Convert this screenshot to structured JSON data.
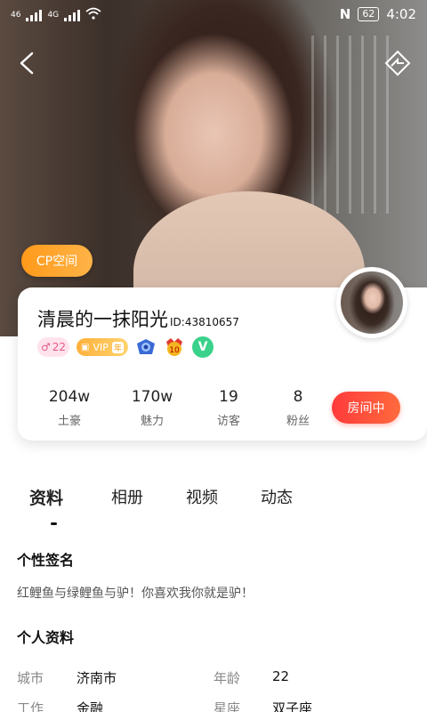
{
  "status_bar": {
    "sim_labels": [
      "46",
      "4G"
    ],
    "battery": "62",
    "time": "4:02",
    "nfc_label": "N"
  },
  "header": {
    "back_icon": "chevron-left-icon",
    "share_icon": "share-icon"
  },
  "cp_button": "CP空间",
  "profile": {
    "nickname": "清晨的一抹阳光",
    "id": "ID:43810657",
    "badges": {
      "fans_level": "22",
      "vip": "VIP",
      "vip_suffix": "年",
      "level_badge": "10",
      "verified": "V"
    },
    "stats": [
      {
        "value": "204w",
        "label": "土豪"
      },
      {
        "value": "170w",
        "label": "魅力"
      },
      {
        "value": "19",
        "label": "访客"
      },
      {
        "value": "8",
        "label": "粉丝"
      }
    ],
    "room_button": "房间中"
  },
  "tabs": [
    "资料",
    "相册",
    "视频",
    "动态"
  ],
  "signature": {
    "title": "个性签名",
    "text": "红鲤鱼与绿鲤鱼与驴！你喜欢我你就是驴！"
  },
  "personal_info": {
    "title": "个人资料",
    "rows": [
      {
        "label": "城市",
        "value": "济南市",
        "label2": "年龄",
        "value2": "22"
      },
      {
        "label": "工作",
        "value": "金融",
        "label2": "星座",
        "value2": "双子座"
      }
    ]
  },
  "colors": {
    "accent_orange": "#ff9a1a",
    "accent_red": "#ff3b3b",
    "verified_green": "#3ad28b"
  }
}
